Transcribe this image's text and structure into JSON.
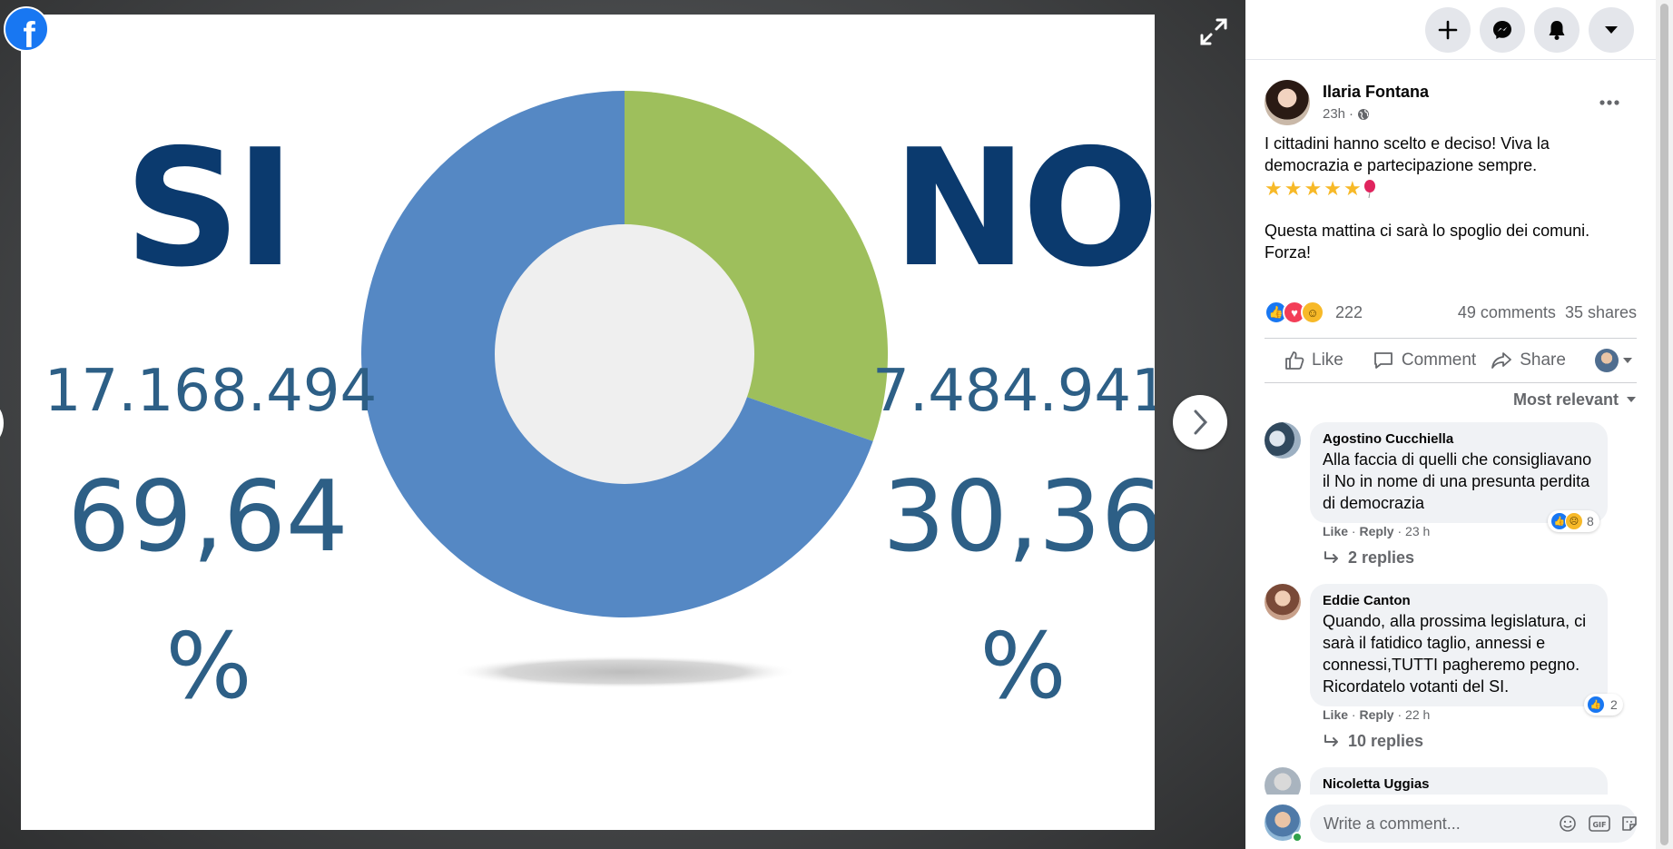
{
  "viewer": {
    "image_text": {
      "si_label": "SI",
      "no_label": "NO",
      "si_votes": "17.168.494",
      "no_votes": "7.484.941",
      "si_percent": "69,64",
      "no_percent": "30,36",
      "si_percent_sign": "%",
      "no_percent_sign": "%"
    },
    "chart_data": {
      "type": "pie",
      "donut": true,
      "categories": [
        "SI",
        "NO"
      ],
      "values": [
        69.64,
        30.36
      ],
      "colors": [
        "#5588c4",
        "#9ebf5c"
      ],
      "title": "",
      "legend": "none"
    },
    "colors": {
      "label_navy": "#0b3a6e",
      "number_blue": "#2d5f86"
    }
  },
  "topbar": {
    "icons": [
      "plus-icon",
      "messenger-icon",
      "bell-icon",
      "caret-down-icon"
    ]
  },
  "post": {
    "author": "Ilaria Fontana",
    "time": "23h",
    "text_line1": "I cittadini hanno scelto e deciso! Viva la democrazia e partecipazione sempre.",
    "text_line2": "Questa mattina ci sarà lo spoglio dei comuni. Forza!",
    "reaction_count": "222",
    "comments_count": "49 comments",
    "shares_count": "35 shares",
    "actions": {
      "like": "Like",
      "comment": "Comment",
      "share": "Share"
    },
    "sort_label": "Most relevant"
  },
  "comments": [
    {
      "name": "Agostino Cucchiella",
      "text": "Alla faccia di quelli che consigliavano il No in nome di una presunta perdita di democrazia",
      "reactions": "8",
      "like": "Like",
      "reply": "Reply",
      "time": "23 h",
      "replies": "2 replies"
    },
    {
      "name": "Eddie Canton",
      "text": "Quando, alla prossima legislatura, ci sarà il fatidico taglio, annessi e connessi,TUTTI pagheremo pegno. Ricordatelo votanti del SI.",
      "reactions": "2",
      "like": "Like",
      "reply": "Reply",
      "time": "22 h",
      "replies": "10 replies"
    },
    {
      "name": "Nicoletta Uggias"
    }
  ],
  "composer": {
    "placeholder": "Write a comment...",
    "gif_label": "GIF"
  },
  "colors": {
    "fb_blue": "#1877f2",
    "love_red": "#f33e58",
    "haha_yellow": "#f7b928",
    "secondary_text": "#65676b"
  }
}
